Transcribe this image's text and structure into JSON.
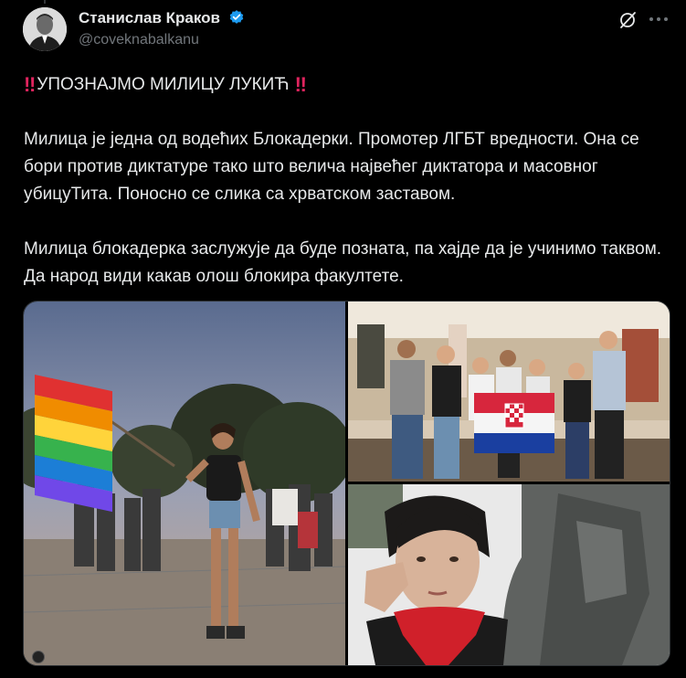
{
  "author": {
    "display_name": "Станислав Краков",
    "handle": "@coveknabalkanu",
    "verified": true,
    "avatar_icon": "avatar-photo"
  },
  "post": {
    "headline": "УПОЗНАЈМО МИЛИЦУ ЛУКИЋ",
    "headline_emoji": "double-exclamation-icon",
    "paragraph1": "Милица је једна од водећих Блокадерки. Промотер ЛГБТ вредности. Она се бори против диктатуре тако што велича највећег диктатора и масовног убицуТита. Поносно се слика са хрватском заставом.",
    "paragraph2": "Милица блокадерка заслужује да буде позната, па хајде да је учинимо таквом. Да народ види какав олош блокира факултете."
  },
  "media": {
    "photos": [
      {
        "icon": "photo-rainbow-flag"
      },
      {
        "icon": "photo-group-croatian-flag"
      },
      {
        "icon": "photo-selfie-statue"
      }
    ]
  },
  "colors": {
    "background": "#000000",
    "text": "#e7e9ea",
    "muted": "#71767b",
    "verified": "#1d9bf0",
    "emoji_red": "#e0245e"
  }
}
